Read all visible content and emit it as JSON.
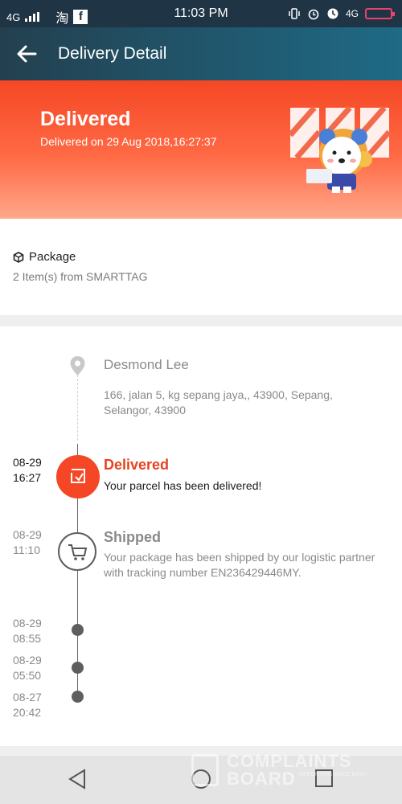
{
  "status_bar": {
    "network_left": "4G",
    "app_icon_1": "淘",
    "app_icon_2": "f",
    "time": "11:03 PM",
    "network_right": "4G"
  },
  "header": {
    "title": "Delivery Detail"
  },
  "hero": {
    "status": "Delivered",
    "subtitle": "Delivered on 29 Aug 2018,16:27:37"
  },
  "package": {
    "label": "Package",
    "items": "2 Item(s) from SMARTTAG"
  },
  "recipient": {
    "name": "Desmond Lee",
    "address": "166, jalan 5, kg sepang jaya,, 43900, Sepang, Selangor, 43900"
  },
  "events": [
    {
      "date": "08-29",
      "time": "16:27",
      "title": "Delivered",
      "desc": "Your parcel has been delivered!"
    },
    {
      "date": "08-29",
      "time": "11:10",
      "title": "Shipped",
      "desc": "Your package has been shipped by our logistic partner with tracking number EN236429446MY."
    },
    {
      "date": "08-29",
      "time": "08:55"
    },
    {
      "date": "08-29",
      "time": "05:50"
    },
    {
      "date": "08-27",
      "time": "20:42"
    }
  ],
  "watermark": {
    "line1": "COMPLAINTS",
    "line2": "BOARD",
    "tagline": "REPORTING MADE EASY"
  },
  "colors": {
    "accent": "#f54725",
    "appbar": "#1f5a72",
    "muted": "#8a8a8a",
    "timeline": "#5e5e5e"
  }
}
